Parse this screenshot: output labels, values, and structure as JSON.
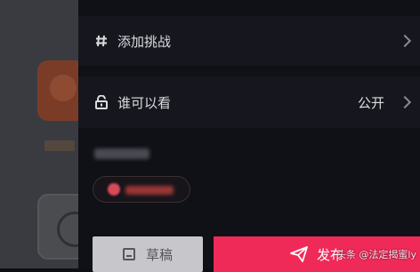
{
  "tags_row": {
    "label": "添加挑战",
    "icon": "hash-icon"
  },
  "visibility_row": {
    "label": "谁可以看",
    "value": "公开",
    "icon": "lock-icon"
  },
  "buttons": {
    "draft_label": "草稿",
    "publish_label": "发布"
  },
  "watermark": {
    "text": "头条 @法定揭蜜ly"
  },
  "colors": {
    "publish": "#f02a58",
    "draft": "#c7c7cb",
    "panel": "#101017"
  }
}
